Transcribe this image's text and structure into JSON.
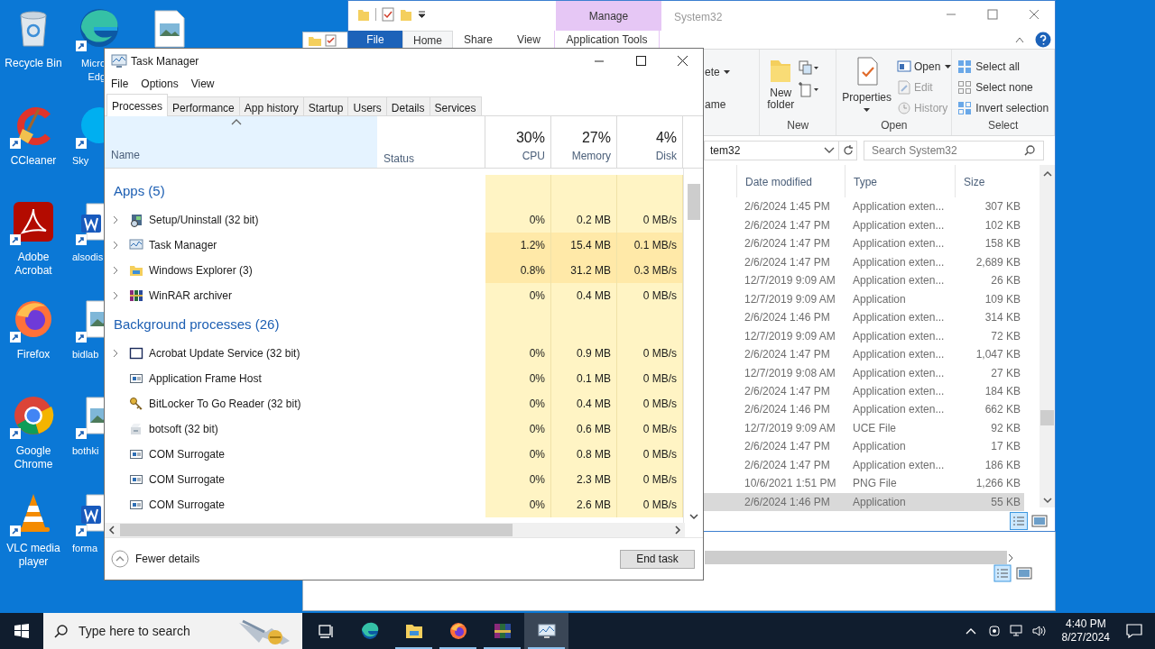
{
  "desktop_icons": [
    {
      "kind": "bin",
      "lines": [
        "Recycle Bin"
      ]
    },
    {
      "kind": "ccleaner",
      "lines": [
        "CCleaner"
      ]
    },
    {
      "kind": "acrobat",
      "lines": [
        "Adobe",
        "Acrobat"
      ]
    },
    {
      "kind": "firefox",
      "lines": [
        "Firefox"
      ]
    },
    {
      "kind": "chrome",
      "lines": [
        "Google",
        "Chrome"
      ]
    },
    {
      "kind": "vlc",
      "lines": [
        "VLC media",
        "player"
      ]
    }
  ],
  "desktop_icons_2": [
    {
      "kind": "edge",
      "lines": [
        "Micro",
        "Edg"
      ]
    },
    {
      "kind": "skype",
      "lines": [
        "Sky"
      ]
    },
    {
      "kind": "word",
      "lines": [
        "alsodis"
      ]
    },
    {
      "kind": "image",
      "lines": [
        "bidlab"
      ]
    },
    {
      "kind": "image",
      "lines": [
        "bothki"
      ]
    },
    {
      "kind": "word",
      "lines": [
        "forma"
      ]
    }
  ],
  "explorer": {
    "title": "System32",
    "context_header": "Manage",
    "tabs": [
      {
        "label": "File",
        "kind": "file",
        "selected": false
      },
      {
        "label": "Home",
        "kind": "tab",
        "selected": true
      },
      {
        "label": "Share",
        "kind": "tab",
        "selected": false
      },
      {
        "label": "View",
        "kind": "tab",
        "selected": false
      },
      {
        "label": "Application Tools",
        "kind": "context",
        "selected": false
      }
    ],
    "ribbon": {
      "organize": [
        "ete",
        "ame"
      ],
      "new_button": [
        "New",
        "folder"
      ],
      "new_group": "New",
      "properties": "Properties",
      "open_items": [
        {
          "label": "Open",
          "disabled": false
        },
        {
          "label": "Edit",
          "disabled": true
        },
        {
          "label": "History",
          "disabled": true
        }
      ],
      "open_group": "Open",
      "select_items": [
        "Select all",
        "Select none",
        "Invert selection"
      ],
      "select_group": "Select"
    },
    "address": "tem32",
    "search": {
      "placeholder": "Search System32"
    },
    "columns": [
      "Date modified",
      "Type",
      "Size"
    ],
    "rows": [
      {
        "date": "2/6/2024 1:45 PM",
        "type": "Application exten...",
        "size": "307 KB",
        "selected": false
      },
      {
        "date": "2/6/2024 1:47 PM",
        "type": "Application exten...",
        "size": "102 KB",
        "selected": false
      },
      {
        "date": "2/6/2024 1:47 PM",
        "type": "Application exten...",
        "size": "158 KB",
        "selected": false
      },
      {
        "date": "2/6/2024 1:47 PM",
        "type": "Application exten...",
        "size": "2,689 KB",
        "selected": false
      },
      {
        "date": "12/7/2019 9:09 AM",
        "type": "Application exten...",
        "size": "26 KB",
        "selected": false
      },
      {
        "date": "12/7/2019 9:09 AM",
        "type": "Application",
        "size": "109 KB",
        "selected": false
      },
      {
        "date": "2/6/2024 1:46 PM",
        "type": "Application exten...",
        "size": "314 KB",
        "selected": false
      },
      {
        "date": "12/7/2019 9:09 AM",
        "type": "Application exten...",
        "size": "72 KB",
        "selected": false
      },
      {
        "date": "2/6/2024 1:47 PM",
        "type": "Application exten...",
        "size": "1,047 KB",
        "selected": false
      },
      {
        "date": "12/7/2019 9:08 AM",
        "type": "Application exten...",
        "size": "27 KB",
        "selected": false
      },
      {
        "date": "2/6/2024 1:47 PM",
        "type": "Application exten...",
        "size": "184 KB",
        "selected": false
      },
      {
        "date": "2/6/2024 1:46 PM",
        "type": "Application exten...",
        "size": "662 KB",
        "selected": false
      },
      {
        "date": "12/7/2019 9:09 AM",
        "type": "UCE File",
        "size": "92 KB",
        "selected": false
      },
      {
        "date": "2/6/2024 1:47 PM",
        "type": "Application",
        "size": "17 KB",
        "selected": false
      },
      {
        "date": "2/6/2024 1:47 PM",
        "type": "Application exten...",
        "size": "186 KB",
        "selected": false
      },
      {
        "date": "10/6/2021 1:51 PM",
        "type": "PNG File",
        "size": "1,266 KB",
        "selected": false
      },
      {
        "date": "2/6/2024 1:46 PM",
        "type": "Application",
        "size": "55 KB",
        "selected": true
      }
    ]
  },
  "task_manager": {
    "title": "Task Manager",
    "menu": [
      "File",
      "Options",
      "View"
    ],
    "tabs": [
      {
        "label": "Processes",
        "selected": true
      },
      {
        "label": "Performance",
        "selected": false
      },
      {
        "label": "App history",
        "selected": false
      },
      {
        "label": "Startup",
        "selected": false
      },
      {
        "label": "Users",
        "selected": false
      },
      {
        "label": "Details",
        "selected": false
      },
      {
        "label": "Services",
        "selected": false
      }
    ],
    "columns": {
      "name": "Name",
      "status": "Status",
      "cpu": {
        "percent": "30%",
        "label": "CPU"
      },
      "memory": {
        "percent": "27%",
        "label": "Memory"
      },
      "disk": {
        "percent": "4%",
        "label": "Disk"
      }
    },
    "groups": [
      {
        "title": "Apps (5)",
        "rows": [
          {
            "kind": "setup",
            "name": "Setup/Uninstall (32 bit)",
            "expandable": true,
            "busy": false,
            "cpu": "0%",
            "memory": "0.2 MB",
            "disk": "0 MB/s"
          },
          {
            "kind": "taskmgr",
            "name": "Task Manager",
            "expandable": true,
            "busy": true,
            "cpu": "1.2%",
            "memory": "15.4 MB",
            "disk": "0.1 MB/s"
          },
          {
            "kind": "folder",
            "name": "Windows Explorer (3)",
            "expandable": true,
            "busy": true,
            "cpu": "0.8%",
            "memory": "31.2 MB",
            "disk": "0.3 MB/s"
          },
          {
            "kind": "winrar",
            "name": "WinRAR archiver",
            "expandable": true,
            "busy": false,
            "cpu": "0%",
            "memory": "0.4 MB",
            "disk": "0 MB/s"
          }
        ]
      },
      {
        "title": "Background processes (26)",
        "rows": [
          {
            "kind": "window",
            "name": "Acrobat Update Service (32 bit)",
            "expandable": true,
            "busy": false,
            "cpu": "0%",
            "memory": "0.9 MB",
            "disk": "0 MB/s"
          },
          {
            "kind": "app",
            "name": "Application Frame Host",
            "expandable": false,
            "busy": false,
            "cpu": "0%",
            "memory": "0.1 MB",
            "disk": "0 MB/s"
          },
          {
            "kind": "key",
            "name": "BitLocker To Go Reader (32 bit)",
            "expandable": false,
            "busy": false,
            "cpu": "0%",
            "memory": "0.4 MB",
            "disk": "0 MB/s"
          },
          {
            "kind": "bot",
            "name": "botsoft (32 bit)",
            "expandable": false,
            "busy": false,
            "cpu": "0%",
            "memory": "0.6 MB",
            "disk": "0 MB/s"
          },
          {
            "kind": "app",
            "name": "COM Surrogate",
            "expandable": false,
            "busy": false,
            "cpu": "0%",
            "memory": "0.8 MB",
            "disk": "0 MB/s"
          },
          {
            "kind": "app",
            "name": "COM Surrogate",
            "expandable": false,
            "busy": false,
            "cpu": "0%",
            "memory": "2.3 MB",
            "disk": "0 MB/s"
          },
          {
            "kind": "app",
            "name": "COM Surrogate",
            "expandable": false,
            "busy": false,
            "cpu": "0%",
            "memory": "2.6 MB",
            "disk": "0 MB/s"
          }
        ]
      }
    ],
    "fewer_details": "Fewer details",
    "end_task": "End task"
  },
  "taskbar": {
    "search": {
      "placeholder": "Type here to search"
    },
    "apps": [
      {
        "kind": "taskview",
        "running": false,
        "selected": false
      },
      {
        "kind": "edge",
        "running": false,
        "selected": false
      },
      {
        "kind": "folder",
        "running": true,
        "selected": false
      },
      {
        "kind": "firefox",
        "running": true,
        "selected": false
      },
      {
        "kind": "winrar",
        "running": true,
        "selected": false
      },
      {
        "kind": "taskmgr",
        "running": true,
        "selected": true
      }
    ],
    "time": "4:40 PM",
    "date": "8/27/2024"
  }
}
